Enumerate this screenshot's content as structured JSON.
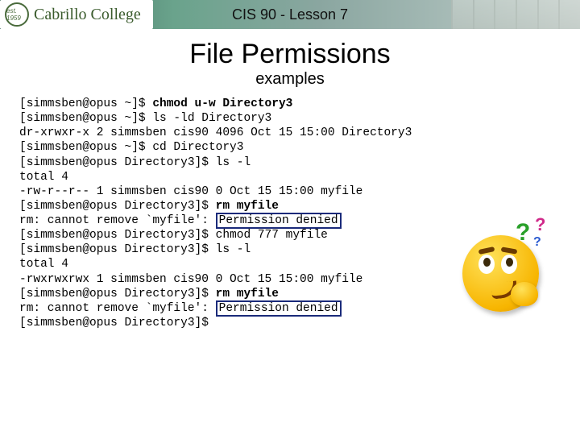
{
  "header": {
    "college": "Cabrillo College",
    "est": "est. 1959",
    "lesson": "CIS 90 - Lesson 7"
  },
  "title": "File Permissions",
  "subtitle": "examples",
  "terminal": {
    "prompt_home": "[simmsben@opus ~]$ ",
    "prompt_dir3": "[simmsben@opus Directory3]$ ",
    "cmd1": "chmod u-w Directory3",
    "cmd2": "ls -ld Directory3",
    "out2": "dr-xrwxr-x 2 simmsben cis90 4096 Oct 15 15:00 Directory3",
    "cmd3": "cd Directory3",
    "cmd4": "ls -l",
    "out4a": "total 4",
    "out4b": "-rw-r--r-- 1 simmsben cis90 0 Oct 15 15:00 myfile",
    "cmd5": "rm myfile",
    "out5_pre": "rm: cannot remove `myfile': ",
    "out5_box": "Permission denied",
    "cmd6": "chmod 777 myfile",
    "cmd7": "ls -l",
    "out7a": "total 4",
    "out7b": "-rwxrwxrwx 1 simmsben cis90 0 Oct 15 15:00 myfile",
    "cmd8": "rm myfile",
    "out8_pre": "rm: cannot remove `myfile': ",
    "out8_box": "Permission denied"
  },
  "qmarks": {
    "q1": "?",
    "q2": "?",
    "q3": "?"
  }
}
